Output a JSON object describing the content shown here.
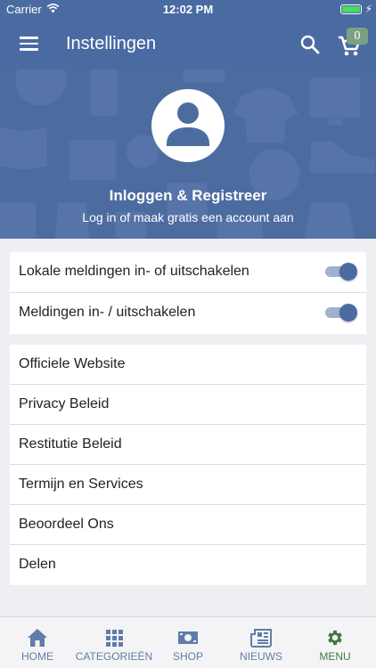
{
  "status_bar": {
    "carrier": "Carrier",
    "time": "12:02 PM"
  },
  "app_bar": {
    "title": "Instellingen",
    "cart_count": "0"
  },
  "header": {
    "login_title": "Inloggen & Registreer",
    "login_subtitle": "Log in of maak gratis een account aan"
  },
  "notification_settings": [
    {
      "label": "Lokale meldingen in- of uitschakelen",
      "enabled": true
    },
    {
      "label": "Meldingen in- / uitschakelen",
      "enabled": true
    }
  ],
  "links": [
    {
      "label": "Officiele Website"
    },
    {
      "label": "Privacy Beleid"
    },
    {
      "label": "Restitutie Beleid"
    },
    {
      "label": "Termijn en Services"
    },
    {
      "label": "Beoordeel Ons"
    },
    {
      "label": "Delen"
    }
  ],
  "tabs": [
    {
      "label": "HOME",
      "icon": "home-icon"
    },
    {
      "label": "CATEGORIEËN",
      "icon": "grid-icon"
    },
    {
      "label": "SHOP",
      "icon": "money-icon"
    },
    {
      "label": "NIEUWS",
      "icon": "newspaper-icon"
    },
    {
      "label": "MENU",
      "icon": "gear-icon",
      "active": true
    }
  ],
  "colors": {
    "primary": "#4a6ba2",
    "accent_green": "#3f7a45",
    "tab_inactive": "#5f7da8",
    "badge": "#7aa183"
  }
}
